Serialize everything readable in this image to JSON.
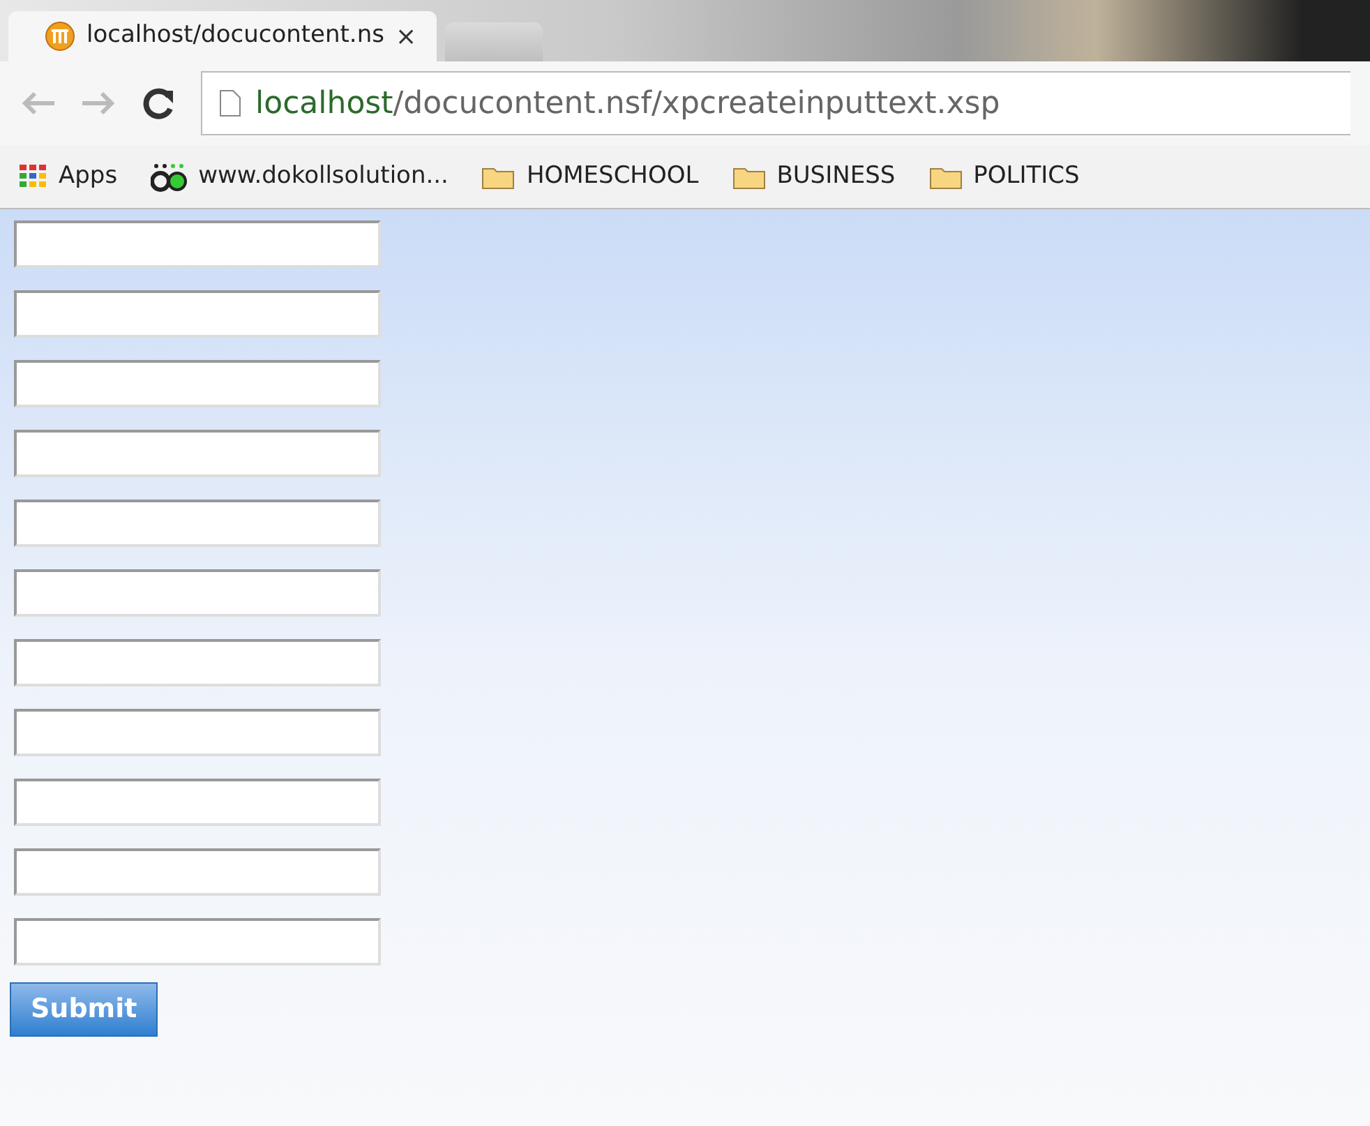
{
  "tabs": [
    {
      "title": "localhost/docucontent.ns",
      "close": "×",
      "selected": true
    },
    {
      "selected": false
    }
  ],
  "address": {
    "host": "localhost",
    "path": "/docucontent.nsf/xpcreateinputtext.xsp"
  },
  "bookmarks": [
    {
      "kind": "apps",
      "label": "Apps"
    },
    {
      "kind": "site",
      "label": "www.dokollsolution..."
    },
    {
      "kind": "folder",
      "label": "HOMESCHOOL"
    },
    {
      "kind": "folder",
      "label": "BUSINESS"
    },
    {
      "kind": "folder",
      "label": "POLITICS"
    }
  ],
  "form": {
    "fields": [
      {
        "kind": "text"
      },
      {
        "kind": "text"
      },
      {
        "kind": "text"
      },
      {
        "kind": "text"
      },
      {
        "kind": "text"
      },
      {
        "kind": "text"
      },
      {
        "kind": "text"
      },
      {
        "kind": "text"
      },
      {
        "kind": "text"
      },
      {
        "kind": "text"
      },
      {
        "kind": "text"
      }
    ],
    "submit": "Submit"
  }
}
